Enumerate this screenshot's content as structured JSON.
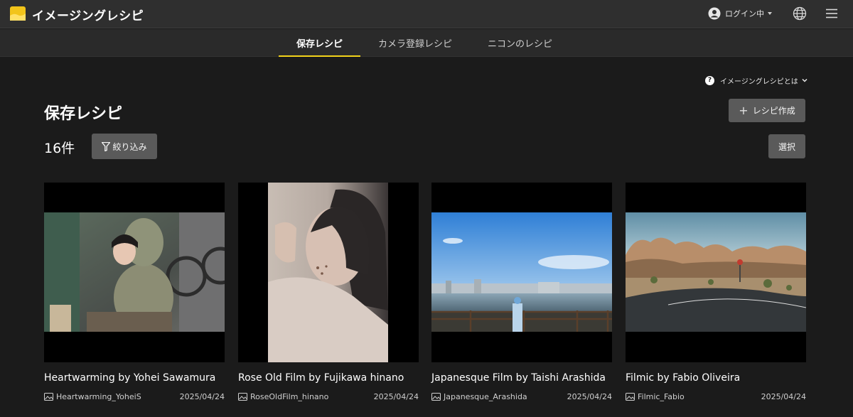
{
  "app": {
    "title": "イメージングレシピ"
  },
  "header": {
    "user_label": "ログイン中"
  },
  "tabs": [
    {
      "label": "保存レシピ",
      "active": true
    },
    {
      "label": "カメラ登録レシピ",
      "active": false
    },
    {
      "label": "ニコンのレシピ",
      "active": false
    }
  ],
  "about": {
    "label": "イメージングレシピとは"
  },
  "main": {
    "title": "保存レシピ",
    "count": "16件",
    "filter_label": "絞り込み",
    "create_label": "レシピ作成",
    "select_label": "選択"
  },
  "recipes": [
    {
      "title": "Heartwarming by Yohei Sawamura",
      "camera": "Heartwarming_YoheiS",
      "date": "2025/04/24"
    },
    {
      "title": "Rose Old Film by Fujikawa hinano",
      "camera": "RoseOldFilm_hinano",
      "date": "2025/04/24"
    },
    {
      "title": "Japanesque Film by Taishi Arashida",
      "camera": "Japanesque_Arashida",
      "date": "2025/04/24"
    },
    {
      "title": "Filmic by Fabio Oliveira",
      "camera": "Filmic_Fabio",
      "date": "2025/04/24"
    }
  ],
  "colors": {
    "accent": "#f2d21a",
    "background": "#1b1b1b",
    "topbar": "#2f2f2f",
    "button": "#5a5a5a"
  }
}
